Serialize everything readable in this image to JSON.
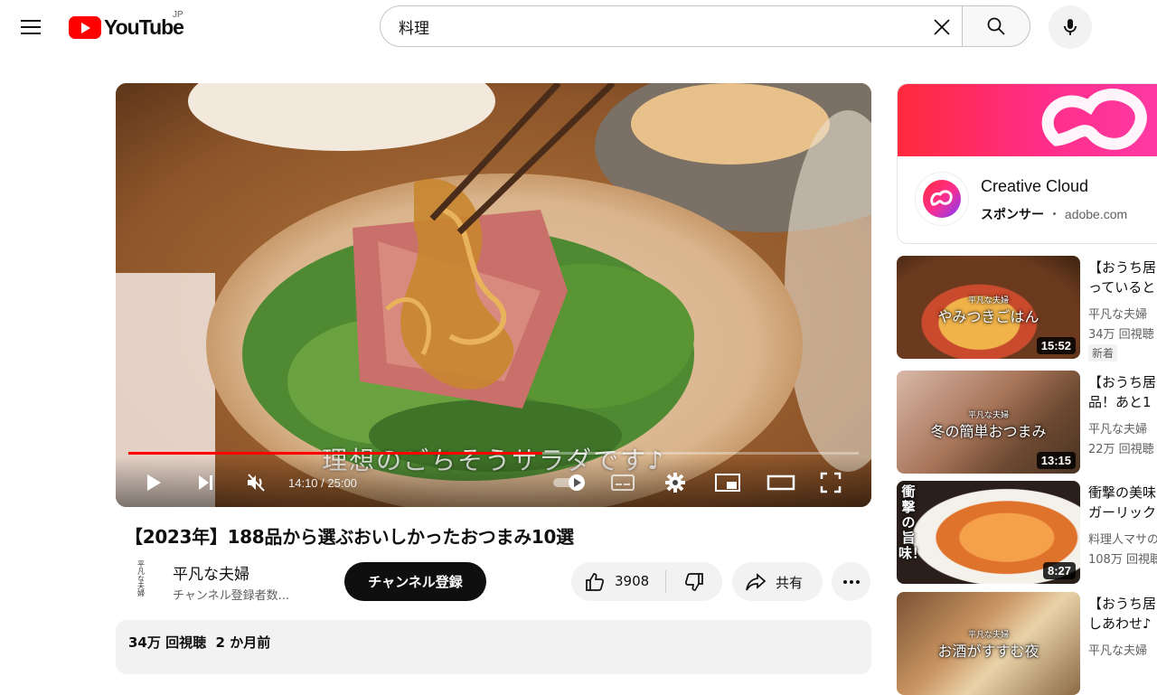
{
  "header": {
    "logo_text": "YouTube",
    "logo_region": "JP",
    "search_value": "料理"
  },
  "player": {
    "subtitle": "理想のごちそうサラダです♪",
    "time": "14:10 / 25:00",
    "progress_fraction": 0.567
  },
  "video": {
    "title": "【2023年】188品から選ぶおいしかったおつまみ10選",
    "channel_avatar_text": "平凡な夫婦",
    "channel_name": "平凡な夫婦",
    "subscriber_text": "チャンネル登録者数...",
    "subscribe_label": "チャンネル登録",
    "like_count": "3908",
    "share_label": "共有",
    "views_and_date": "34万 回視聴  2 か月前"
  },
  "ad": {
    "title": "Creative Cloud",
    "sponsor_label": "スポンサー",
    "separator": "・",
    "domain": "adobe.com"
  },
  "recommendations": [
    {
      "title": "【おうち居酒屋】っていると",
      "title_line1": "【おうち居",
      "title_line2": "っていると",
      "channel": "平凡な夫婦",
      "views": "34万 回視聴",
      "badge": "新着",
      "duration": "15:52",
      "thumb_text_small": "平凡な夫婦",
      "thumb_text": "やみつきごはん"
    },
    {
      "title_line1": "【おうち居",
      "title_line2": "品！あと1",
      "channel": "平凡な夫婦",
      "views": "22万 回視聴",
      "duration": "13:15",
      "thumb_text_small": "平凡な夫婦",
      "thumb_text": "冬の簡単おつまみ"
    },
    {
      "title_line1": "衝撃の美味",
      "title_line2": "ガーリック",
      "channel": "料理人マサの",
      "views": "108万 回視聴",
      "duration": "8:27",
      "thumb_text": "衝撃の旨味！"
    },
    {
      "title_line1": "【おうち居",
      "title_line2": "しあわせ♪",
      "channel": "平凡な夫婦",
      "thumb_text_small": "平凡な夫婦",
      "thumb_text": "お酒がすすむ夜"
    }
  ],
  "colors": {
    "brand_red": "#ff0000",
    "subscribe_bg": "#0f0f0f"
  }
}
